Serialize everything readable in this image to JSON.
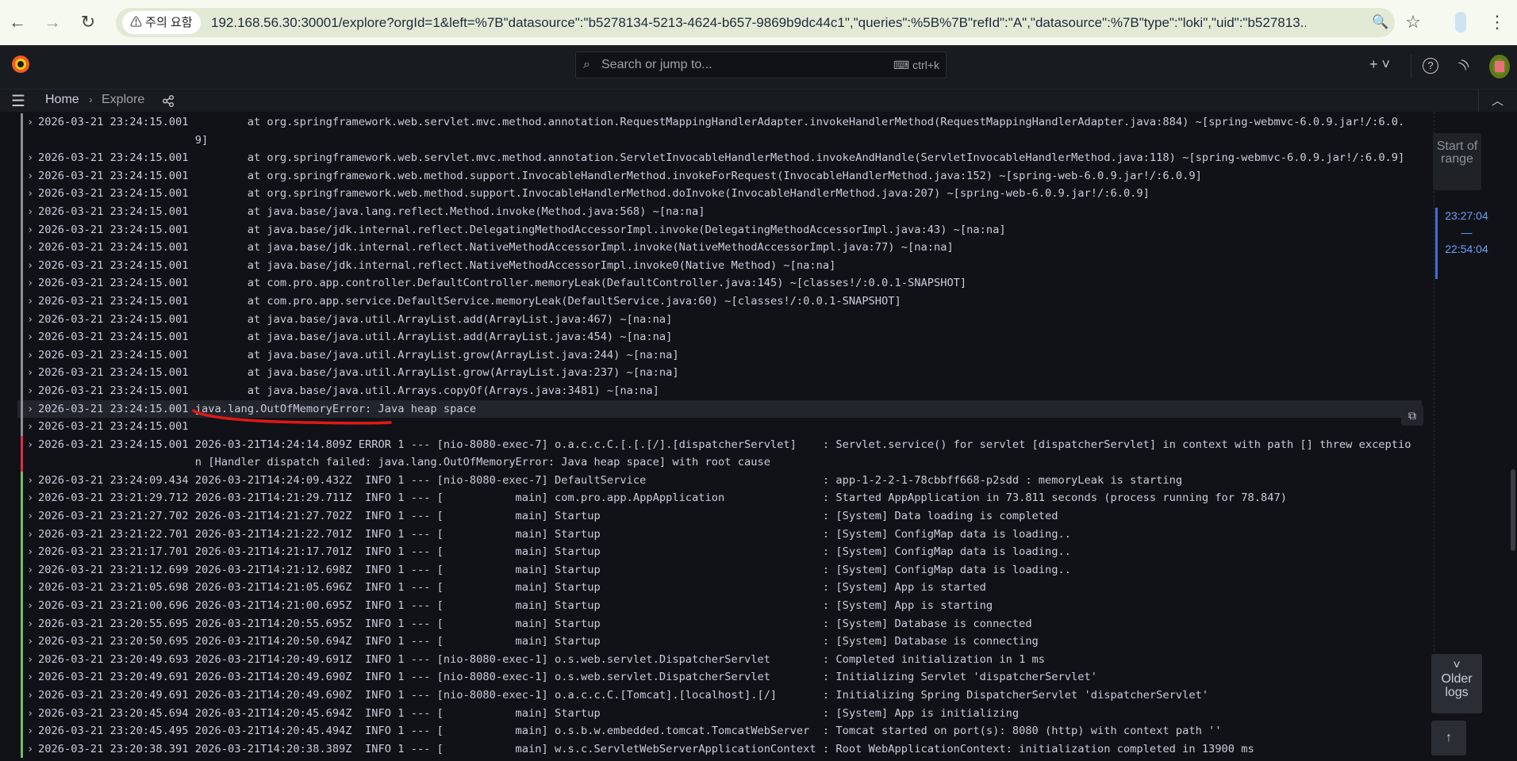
{
  "browser": {
    "back": "←",
    "forward": "→",
    "reload": "↻",
    "warning": "⚠ 주의 요함",
    "url": "192.168.56.30:30001/explore?orgId=1&left=%7B\"datasource\":\"b5278134-5213-4624-b657-9869b9dc44c1\",\"queries\":%5B%7B\"refId\":\"A\",\"datasource\":%7B\"type\":\"loki\",\"uid\":\"b527813...",
    "zoom": "🔍",
    "star": "☆",
    "menu": "⋮"
  },
  "topnav": {
    "search_placeholder": "Search or jump to...",
    "shortcut": "ctrl+k",
    "add": "+ ˅",
    "help": "?",
    "news": "))"
  },
  "breadcrumb": {
    "home": "Home",
    "sep": "›",
    "current": "Explore"
  },
  "colors": {
    "unknown": "#8e8e95",
    "error": "#e02f44",
    "info": "#73bf69",
    "accent": "#6e9fff"
  },
  "logs": [
    {
      "level": "unknown",
      "ts": "2026-03-21 23:24:15.001",
      "msg": "\tat org.springframework.web.servlet.mvc.method.annotation.RequestMappingHandlerAdapter.invokeHandlerMethod(RequestMappingHandlerAdapter.java:884) ~[spring-webmvc-6.0.9.jar!/:6.0.9]"
    },
    {
      "level": "unknown",
      "ts": "2026-03-21 23:24:15.001",
      "msg": "\tat org.springframework.web.servlet.mvc.method.annotation.ServletInvocableHandlerMethod.invokeAndHandle(ServletInvocableHandlerMethod.java:118) ~[spring-webmvc-6.0.9.jar!/:6.0.9]"
    },
    {
      "level": "unknown",
      "ts": "2026-03-21 23:24:15.001",
      "msg": "\tat org.springframework.web.method.support.InvocableHandlerMethod.invokeForRequest(InvocableHandlerMethod.java:152) ~[spring-web-6.0.9.jar!/:6.0.9]"
    },
    {
      "level": "unknown",
      "ts": "2026-03-21 23:24:15.001",
      "msg": "\tat org.springframework.web.method.support.InvocableHandlerMethod.doInvoke(InvocableHandlerMethod.java:207) ~[spring-web-6.0.9.jar!/:6.0.9]"
    },
    {
      "level": "unknown",
      "ts": "2026-03-21 23:24:15.001",
      "msg": "\tat java.base/java.lang.reflect.Method.invoke(Method.java:568) ~[na:na]"
    },
    {
      "level": "unknown",
      "ts": "2026-03-21 23:24:15.001",
      "msg": "\tat java.base/jdk.internal.reflect.DelegatingMethodAccessorImpl.invoke(DelegatingMethodAccessorImpl.java:43) ~[na:na]"
    },
    {
      "level": "unknown",
      "ts": "2026-03-21 23:24:15.001",
      "msg": "\tat java.base/jdk.internal.reflect.NativeMethodAccessorImpl.invoke(NativeMethodAccessorImpl.java:77) ~[na:na]"
    },
    {
      "level": "unknown",
      "ts": "2026-03-21 23:24:15.001",
      "msg": "\tat java.base/jdk.internal.reflect.NativeMethodAccessorImpl.invoke0(Native Method) ~[na:na]"
    },
    {
      "level": "unknown",
      "ts": "2026-03-21 23:24:15.001",
      "msg": "\tat com.pro.app.controller.DefaultController.memoryLeak(DefaultController.java:145) ~[classes!/:0.0.1-SNAPSHOT]"
    },
    {
      "level": "unknown",
      "ts": "2026-03-21 23:24:15.001",
      "msg": "\tat com.pro.app.service.DefaultService.memoryLeak(DefaultService.java:60) ~[classes!/:0.0.1-SNAPSHOT]"
    },
    {
      "level": "unknown",
      "ts": "2026-03-21 23:24:15.001",
      "msg": "\tat java.base/java.util.ArrayList.add(ArrayList.java:467) ~[na:na]"
    },
    {
      "level": "unknown",
      "ts": "2026-03-21 23:24:15.001",
      "msg": "\tat java.base/java.util.ArrayList.add(ArrayList.java:454) ~[na:na]"
    },
    {
      "level": "unknown",
      "ts": "2026-03-21 23:24:15.001",
      "msg": "\tat java.base/java.util.ArrayList.grow(ArrayList.java:244) ~[na:na]"
    },
    {
      "level": "unknown",
      "ts": "2026-03-21 23:24:15.001",
      "msg": "\tat java.base/java.util.ArrayList.grow(ArrayList.java:237) ~[na:na]"
    },
    {
      "level": "unknown",
      "ts": "2026-03-21 23:24:15.001",
      "msg": "\tat java.base/java.util.Arrays.copyOf(Arrays.java:3481) ~[na:na]"
    },
    {
      "level": "unknown",
      "ts": "2026-03-21 23:24:15.001",
      "msg": "java.lang.OutOfMemoryError: Java heap space",
      "highlight": true
    },
    {
      "level": "unknown",
      "ts": "2026-03-21 23:24:15.001",
      "msg": ""
    },
    {
      "level": "error",
      "ts": "2026-03-21 23:24:15.001",
      "msg": "2026-03-21T14:24:14.809Z ERROR 1 --- [nio-8080-exec-7] o.a.c.c.C.[.[.[/].[dispatcherServlet]    : Servlet.service() for servlet [dispatcherServlet] in context with path [] threw exception [Handler dispatch failed: java.lang.OutOfMemoryError: Java heap space] with root cause"
    },
    {
      "level": "info",
      "ts": "2026-03-21 23:24:09.434",
      "msg": "2026-03-21T14:24:09.432Z  INFO 1 --- [nio-8080-exec-7] DefaultService                           : app-1-2-2-1-78cbbff668-p2sdd : memoryLeak is starting"
    },
    {
      "level": "info",
      "ts": "2026-03-21 23:21:29.712",
      "msg": "2026-03-21T14:21:29.711Z  INFO 1 --- [           main] com.pro.app.AppApplication               : Started AppApplication in 73.811 seconds (process running for 78.847)"
    },
    {
      "level": "info",
      "ts": "2026-03-21 23:21:27.702",
      "msg": "2026-03-21T14:21:27.702Z  INFO 1 --- [           main] Startup                                  : [System] Data loading is completed"
    },
    {
      "level": "info",
      "ts": "2026-03-21 23:21:22.701",
      "msg": "2026-03-21T14:21:22.701Z  INFO 1 --- [           main] Startup                                  : [System] ConfigMap data is loading.."
    },
    {
      "level": "info",
      "ts": "2026-03-21 23:21:17.701",
      "msg": "2026-03-21T14:21:17.701Z  INFO 1 --- [           main] Startup                                  : [System] ConfigMap data is loading.."
    },
    {
      "level": "info",
      "ts": "2026-03-21 23:21:12.699",
      "msg": "2026-03-21T14:21:12.698Z  INFO 1 --- [           main] Startup                                  : [System] ConfigMap data is loading.."
    },
    {
      "level": "info",
      "ts": "2026-03-21 23:21:05.698",
      "msg": "2026-03-21T14:21:05.696Z  INFO 1 --- [           main] Startup                                  : [System] App is started"
    },
    {
      "level": "info",
      "ts": "2026-03-21 23:21:00.696",
      "msg": "2026-03-21T14:21:00.695Z  INFO 1 --- [           main] Startup                                  : [System] App is starting"
    },
    {
      "level": "info",
      "ts": "2026-03-21 23:20:55.695",
      "msg": "2026-03-21T14:20:55.695Z  INFO 1 --- [           main] Startup                                  : [System] Database is connected"
    },
    {
      "level": "info",
      "ts": "2026-03-21 23:20:50.695",
      "msg": "2026-03-21T14:20:50.694Z  INFO 1 --- [           main] Startup                                  : [System] Database is connecting"
    },
    {
      "level": "info",
      "ts": "2026-03-21 23:20:49.693",
      "msg": "2026-03-21T14:20:49.691Z  INFO 1 --- [nio-8080-exec-1] o.s.web.servlet.DispatcherServlet        : Completed initialization in 1 ms"
    },
    {
      "level": "info",
      "ts": "2026-03-21 23:20:49.691",
      "msg": "2026-03-21T14:20:49.690Z  INFO 1 --- [nio-8080-exec-1] o.s.web.servlet.DispatcherServlet        : Initializing Servlet 'dispatcherServlet'"
    },
    {
      "level": "info",
      "ts": "2026-03-21 23:20:49.691",
      "msg": "2026-03-21T14:20:49.690Z  INFO 1 --- [nio-8080-exec-1] o.a.c.c.C.[Tomcat].[localhost].[/]       : Initializing Spring DispatcherServlet 'dispatcherServlet'"
    },
    {
      "level": "info",
      "ts": "2026-03-21 23:20:45.694",
      "msg": "2026-03-21T14:20:45.694Z  INFO 1 --- [           main] Startup                                  : [System] App is initializing"
    },
    {
      "level": "info",
      "ts": "2026-03-21 23:20:45.495",
      "msg": "2026-03-21T14:20:45.494Z  INFO 1 --- [           main] o.s.b.w.embedded.tomcat.TomcatWebServer  : Tomcat started on port(s): 8080 (http) with context path ''"
    },
    {
      "level": "info",
      "ts": "2026-03-21 23:20:38.391",
      "msg": "2026-03-21T14:20:38.389Z  INFO 1 --- [           main] w.s.c.ServletWebServerApplicationContext : Root WebApplicationContext: initialization completed in 13900 ms"
    }
  ],
  "side": {
    "start_of_range": "Start of range",
    "range_from": "23:27:04",
    "range_dash": "—",
    "range_to": "22:54:04",
    "older_chevron": "˅",
    "older_logs": "Older logs",
    "scroll_top": "↑"
  }
}
